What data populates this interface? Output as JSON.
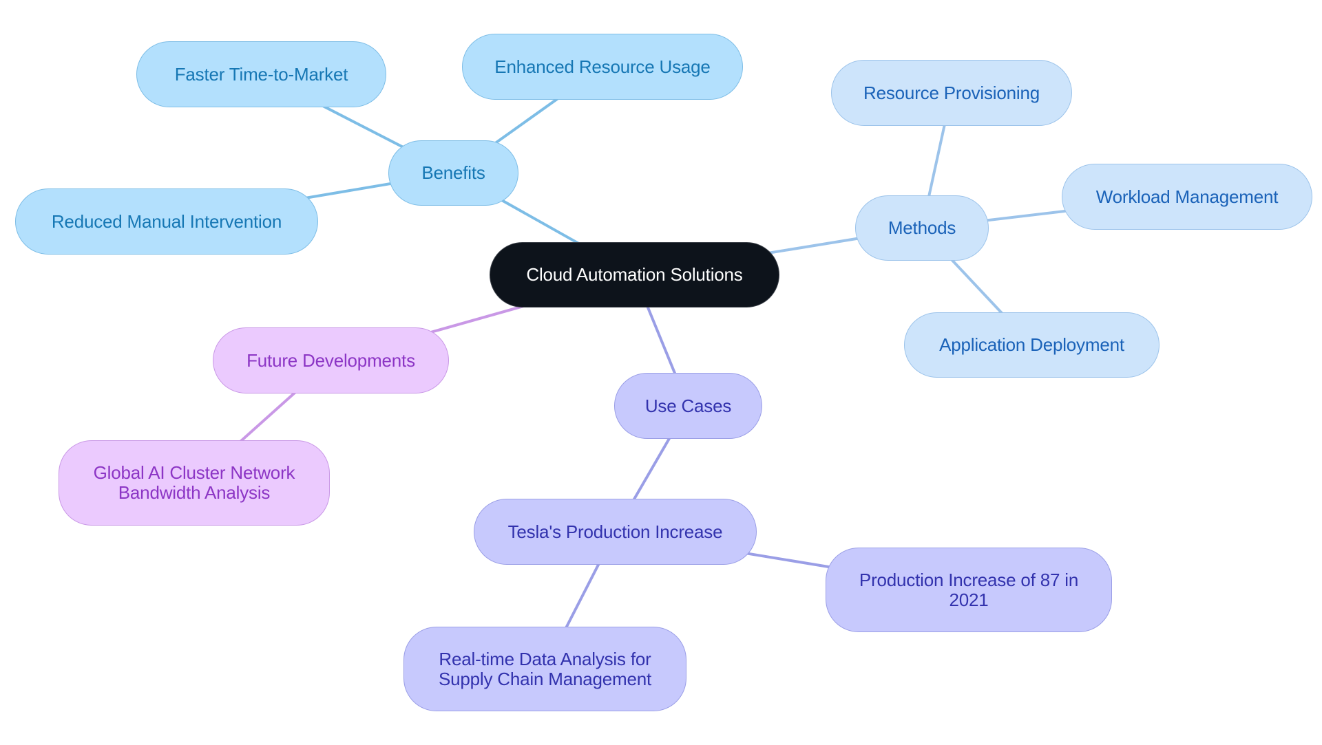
{
  "diagram": {
    "type": "mind-map",
    "root": {
      "id": "root",
      "label": "Cloud Automation Solutions"
    },
    "colors": {
      "root_fill": "#0d131b",
      "root_text": "#ffffff",
      "benefits_fill": "#b3e0fd",
      "benefits_text": "#1677b4",
      "benefits_line": "#7dbde6",
      "methods_fill": "#cde4fb",
      "methods_text": "#1a62b8",
      "methods_line": "#9cc3ea",
      "usecases_fill": "#c7c9fd",
      "usecases_text": "#3232ad",
      "usecases_line": "#9a9ee6",
      "future_fill": "#ebcafe",
      "future_text": "#8c35c5",
      "future_line": "#c998e6"
    },
    "nodes": [
      {
        "id": "benefits",
        "label": "Benefits",
        "parent": "root",
        "branch": "benefits"
      },
      {
        "id": "faster",
        "label": "Faster Time-to-Market",
        "parent": "benefits",
        "branch": "benefits"
      },
      {
        "id": "enhanced",
        "label": "Enhanced Resource Usage",
        "parent": "benefits",
        "branch": "benefits"
      },
      {
        "id": "reduced",
        "label": "Reduced Manual Intervention",
        "parent": "benefits",
        "branch": "benefits"
      },
      {
        "id": "methods",
        "label": "Methods",
        "parent": "root",
        "branch": "methods"
      },
      {
        "id": "provisioning",
        "label": "Resource Provisioning",
        "parent": "methods",
        "branch": "methods"
      },
      {
        "id": "workload",
        "label": "Workload Management",
        "parent": "methods",
        "branch": "methods"
      },
      {
        "id": "deployment",
        "label": "Application Deployment",
        "parent": "methods",
        "branch": "methods"
      },
      {
        "id": "usecases",
        "label": "Use Cases",
        "parent": "root",
        "branch": "usecases"
      },
      {
        "id": "tesla",
        "label": "Tesla's Production Increase",
        "parent": "usecases",
        "branch": "usecases"
      },
      {
        "id": "increase",
        "label": "Production Increase of 87 in 2021",
        "parent": "tesla",
        "branch": "usecases"
      },
      {
        "id": "realtime",
        "label": "Real-time Data Analysis for Supply Chain Management",
        "parent": "tesla",
        "branch": "usecases"
      },
      {
        "id": "future",
        "label": "Future Developments",
        "parent": "root",
        "branch": "future"
      },
      {
        "id": "global",
        "label": "Global AI Cluster Network Bandwidth Analysis",
        "parent": "future",
        "branch": "future"
      }
    ]
  }
}
